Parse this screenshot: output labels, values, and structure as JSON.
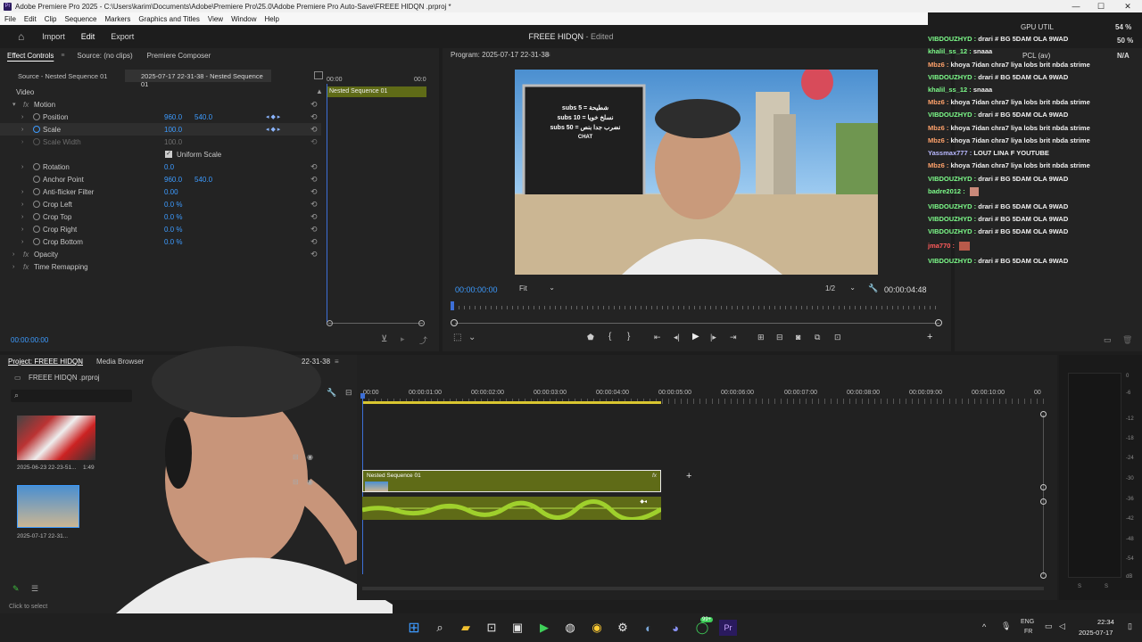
{
  "window": {
    "title": "Adobe Premiere Pro 2025 - C:\\Users\\karim\\Documents\\Adobe\\Premiere Pro\\25.0\\Adobe Premiere Pro Auto-Save\\FREEE HIDQN .prproj *"
  },
  "menu": [
    "File",
    "Edit",
    "Clip",
    "Sequence",
    "Markers",
    "Graphics and Titles",
    "View",
    "Window",
    "Help"
  ],
  "header": {
    "import": "Import",
    "edit": "Edit",
    "export": "Export",
    "project_title": "FREEE HIDQN",
    "project_status": "- Edited"
  },
  "effect_controls": {
    "tabs": [
      "Effect Controls",
      "Source: (no clips)",
      "Premiere Composer"
    ],
    "source_label": "Source - Nested Sequence 01",
    "seq_label": "2025-07-17 22-31-38 - Nested Sequence 01",
    "ruler_start": "00:00",
    "ruler_end": "00:0",
    "clip_name": "Nested Sequence 01",
    "video_header": "Video",
    "motion": "Motion",
    "position": {
      "label": "Position",
      "x": "960.0",
      "y": "540.0"
    },
    "scale": {
      "label": "Scale",
      "v": "100.0"
    },
    "scale_width": {
      "label": "Scale Width",
      "v": "100.0"
    },
    "uniform": "Uniform Scale",
    "rotation": {
      "label": "Rotation",
      "v": "0.0"
    },
    "anchor": {
      "label": "Anchor Point",
      "x": "960.0",
      "y": "540.0"
    },
    "flicker": {
      "label": "Anti-flicker Filter",
      "v": "0.00"
    },
    "crop_left": {
      "label": "Crop Left",
      "v": "0.0 %"
    },
    "crop_top": {
      "label": "Crop Top",
      "v": "0.0 %"
    },
    "crop_right": {
      "label": "Crop Right",
      "v": "0.0 %"
    },
    "crop_bottom": {
      "label": "Crop Bottom",
      "v": "0.0 %"
    },
    "opacity": "Opacity",
    "remap": "Time Remapping",
    "timecode": "00:00:00:00"
  },
  "program": {
    "title": "Program: 2025-07-17 22-31-38",
    "timecode": "00:00:00:00",
    "fit": "Fit",
    "res": "1/2",
    "duration": "00:00:04:48",
    "board": [
      "subs 5 = شطيحة",
      "subs 10 = نسلخ خويا",
      "subs 50 = نضرب جدا بنص",
      "CHAT"
    ]
  },
  "project": {
    "tabs": [
      "Project: FREEE HIDQN",
      "Media Browser"
    ],
    "file": "FREEE HIDQN .prproj",
    "item1": "2025-06-23 22-23-51...",
    "item1_dur": "1:49",
    "item2": "2025-07-17 22-31...",
    "status": "Click to select"
  },
  "timeline": {
    "seq": "22-31-38",
    "ruler": [
      "00:00",
      "00:00:01:00",
      "00:00:02:00",
      "00:00:03:00",
      "00:00:04:00",
      "00:00:05:00",
      "00:00:06:00",
      "00:00:07:00",
      "00:00:08:00",
      "00:00:09:00",
      "00:00:10:00",
      "00"
    ],
    "clip": "Nested Sequence 01",
    "fx": "fx"
  },
  "meter": {
    "labels": [
      "0",
      "-6",
      "-12",
      "-18",
      "-24",
      "-30",
      "-36",
      "-42",
      "-48",
      "-54",
      "dB"
    ],
    "s": "S"
  },
  "chat": {
    "gpu": "GPU UTIL",
    "gpu_val": "54 %",
    "pcl": "PCL (av)",
    "na": "N/A",
    "pct": "50 %",
    "lines": [
      {
        "u": "khalil_ss_12 :",
        "m": "snaaa"
      },
      {
        "u": "VIBDOUZHYD :",
        "m": "drari # BG 5DAM OLA 9WAD"
      },
      {
        "u": "Mbz6 :",
        "m": "khoya 7idan chra7 liya lobs brit nbda strime"
      },
      {
        "u": "VIBDOUZHYD :",
        "m": "drari # BG 5DAM OLA 9WAD"
      },
      {
        "u": "khalil_ss_12 :",
        "m": "snaaa"
      },
      {
        "u": "Mbz6 :",
        "m": "khoya 7idan chra7 liya lobs brit nbda strime"
      },
      {
        "u": "VIBDOUZHYD :",
        "m": "drari # BG 5DAM OLA 9WAD"
      },
      {
        "u": "Mbz6 :",
        "m": "khoya 7idan chra7 liya lobs brit nbda strime"
      },
      {
        "u": "Mbz6 :",
        "m": "khoya 7idan chra7 liya lobs brit nbda strime"
      },
      {
        "u": "Yassmax777 :",
        "m": "LOU7 LINA F YOUTUBE"
      },
      {
        "u": "Mbz6 :",
        "m": "khoya 7idan chra7 liya lobs brit nbda strime"
      },
      {
        "u": "VIBDOUZHYD :",
        "m": "drari # BG 5DAM OLA 9WAD"
      },
      {
        "u": "badre2012 :",
        "m": ""
      },
      {
        "u": "VIBDOUZHYD :",
        "m": "drari # BG 5DAM OLA 9WAD"
      },
      {
        "u": "VIBDOUZHYD :",
        "m": "drari # BG 5DAM OLA 9WAD"
      },
      {
        "u": "VIBDOUZHYD :",
        "m": "drari # BG 5DAM OLA 9WAD"
      },
      {
        "u": "jma770 :",
        "m": ""
      },
      {
        "u": "VIBDOUZHYD :",
        "m": "drari # BG 5DAM OLA 9WAD"
      }
    ]
  },
  "taskbar": {
    "lang1": "ENG",
    "lang2": "FR",
    "time": "22:34",
    "date": "2025-07-17",
    "badge": "99+"
  }
}
